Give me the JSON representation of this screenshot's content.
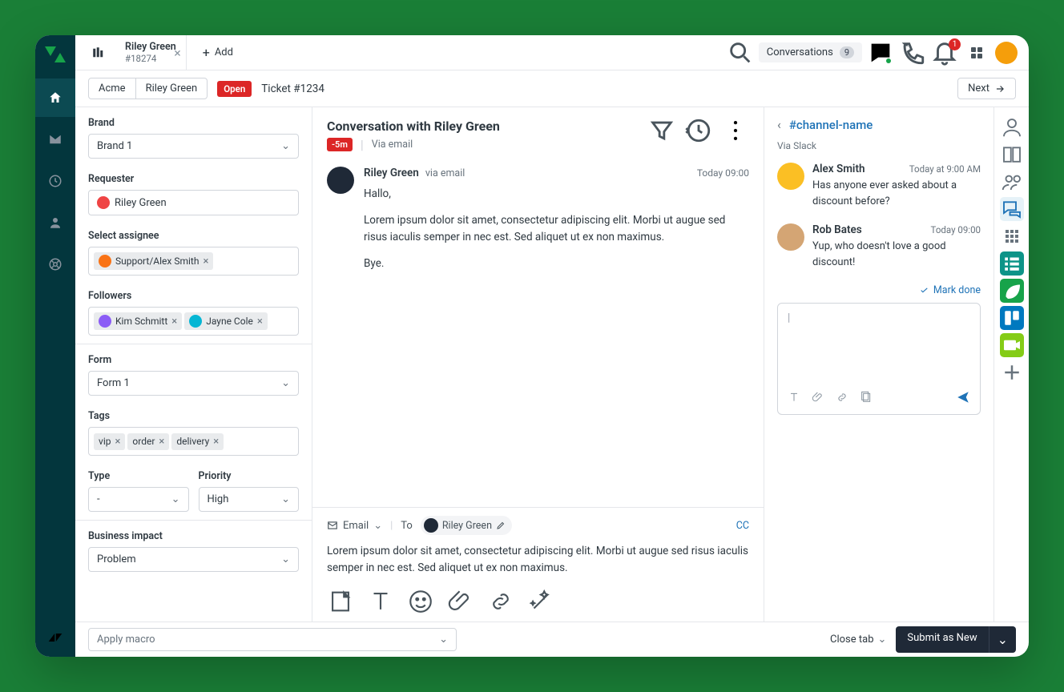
{
  "topbar": {
    "tab": {
      "title": "Riley Green",
      "subtitle": "#18274"
    },
    "add_label": "Add",
    "conversations_label": "Conversations",
    "conversations_count": "9",
    "notifications_count": "1"
  },
  "breadcrumb": {
    "org": "Acme",
    "requester": "Riley Green",
    "status": "Open",
    "ticket": "Ticket #1234",
    "next_label": "Next"
  },
  "left": {
    "brand_label": "Brand",
    "brand_value": "Brand 1",
    "requester_label": "Requester",
    "requester_value": "Riley Green",
    "assignee_label": "Select assignee",
    "assignee_value": "Support/Alex Smith",
    "followers_label": "Followers",
    "followers": [
      "Kim Schmitt",
      "Jayne Cole"
    ],
    "form_label": "Form",
    "form_value": "Form 1",
    "tags_label": "Tags",
    "tags": [
      "vip",
      "order",
      "delivery"
    ],
    "type_label": "Type",
    "type_value": "-",
    "priority_label": "Priority",
    "priority_value": "High",
    "impact_label": "Business impact",
    "impact_value": "Problem"
  },
  "center": {
    "title": "Conversation with Riley Green",
    "sla": "-5m",
    "via": "Via email",
    "message": {
      "author": "Riley Green",
      "via": "via email",
      "time": "Today 09:00",
      "greeting": "Hallo,",
      "body": "Lorem ipsum dolor sit amet, consectetur adipiscing elit. Morbi ut augue sed risus iaculis semper in nec est. Sed aliquet ut ex non maximus.",
      "signoff": "Bye."
    },
    "compose_channel": "Email",
    "compose_to_label": "To",
    "compose_to": "Riley Green",
    "compose_cc": "CC",
    "compose_body": "Lorem ipsum dolor sit amet, consectetur adipiscing elit. Morbi ut augue sed risus iaculis semper in nec est. Sed aliquet ut ex non maximus."
  },
  "right": {
    "channel": "#channel-name",
    "via": "Via Slack",
    "messages": [
      {
        "author": "Alex Smith",
        "time": "Today at 9:00 AM",
        "text": "Has anyone ever asked about a discount before?"
      },
      {
        "author": "Rob Bates",
        "time": "Today 09:00",
        "text": "Yup, who doesn't love a good discount!"
      }
    ],
    "mark_done": "Mark done",
    "cursor": "|"
  },
  "footer": {
    "macro_placeholder": "Apply macro",
    "close_tab": "Close tab",
    "submit": "Submit as New"
  }
}
